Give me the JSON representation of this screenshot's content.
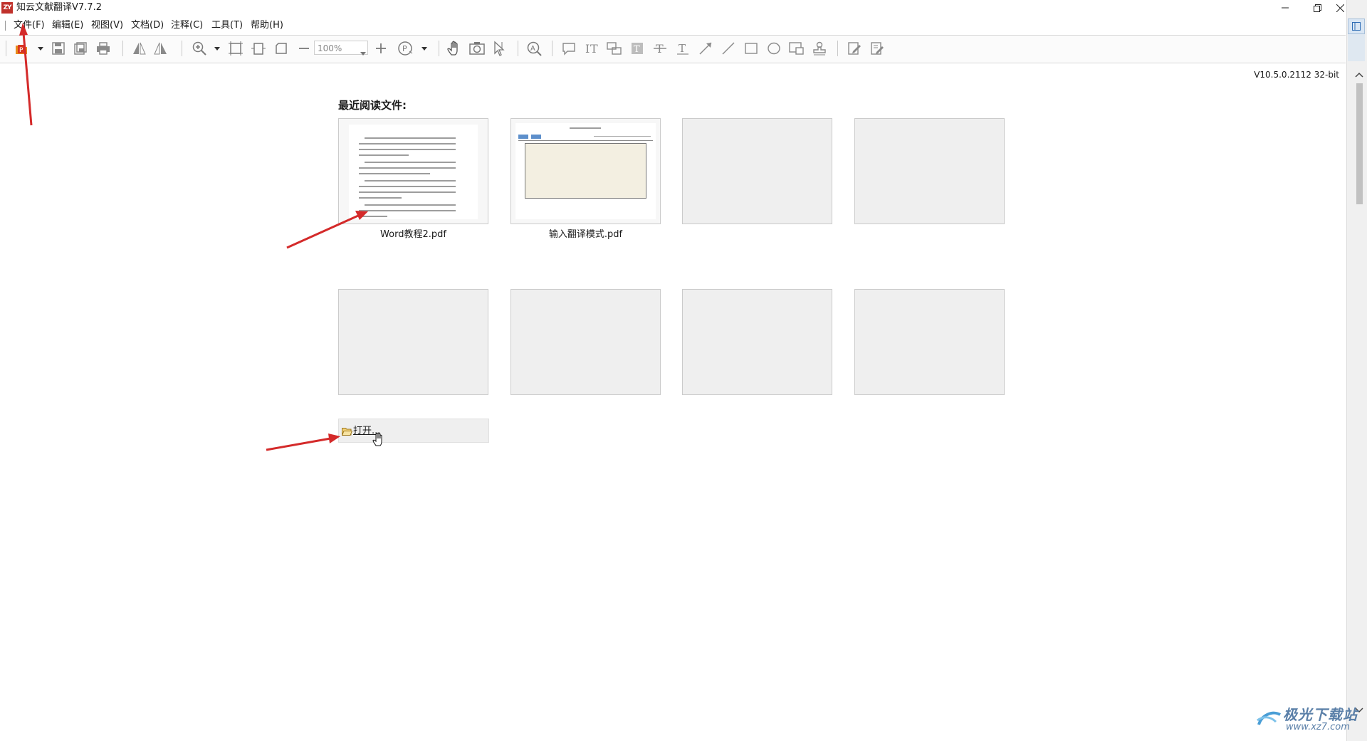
{
  "window": {
    "title": "知云文献翻译V7.7.2",
    "logo_text": "ZY"
  },
  "menu": {
    "items": [
      "文件(F)",
      "编辑(E)",
      "视图(V)",
      "文档(D)",
      "注释(C)",
      "工具(T)",
      "帮助(H)"
    ]
  },
  "toolbar": {
    "zoom_value": "100%"
  },
  "version": "V10.5.0.2112 32-bit",
  "recent": {
    "title": "最近阅读文件:",
    "files": [
      {
        "name": "Word教程2.pdf"
      },
      {
        "name": "输入翻译模式.pdf"
      }
    ]
  },
  "open_button": {
    "label": "打开..."
  },
  "watermark": {
    "brand": "极光下载站",
    "url": "www.xz7.com"
  },
  "colors": {
    "annotation_arrow": "#d42a2a",
    "accent": "#2f6db5"
  }
}
